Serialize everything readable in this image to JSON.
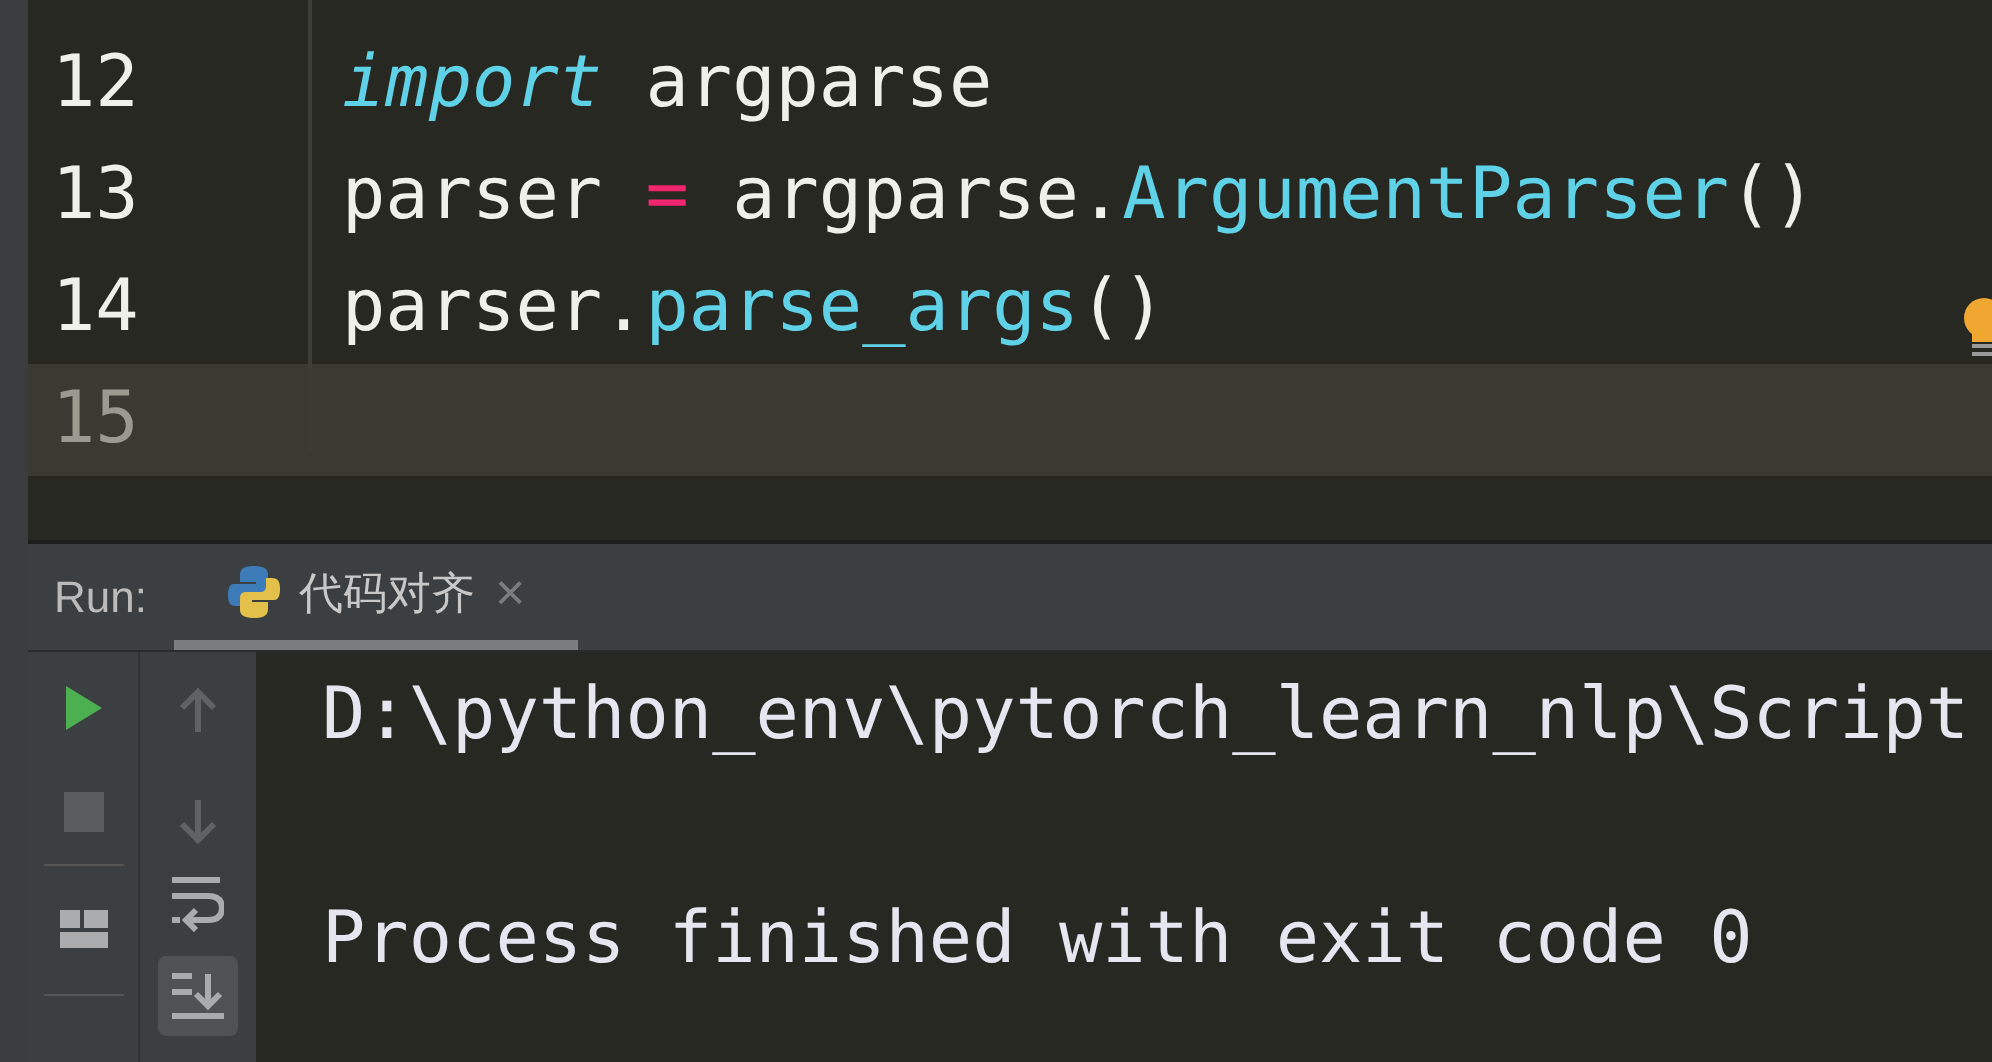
{
  "editor": {
    "lines": [
      {
        "number": "12",
        "current": false,
        "tokens": [
          {
            "text": "import",
            "kind": "keyword"
          },
          {
            "text": " argparse",
            "kind": "plain"
          }
        ]
      },
      {
        "number": "13",
        "current": false,
        "tokens": [
          {
            "text": "parser ",
            "kind": "plain"
          },
          {
            "text": "=",
            "kind": "operator"
          },
          {
            "text": " argparse.",
            "kind": "plain"
          },
          {
            "text": "ArgumentParser",
            "kind": "call"
          },
          {
            "text": "()",
            "kind": "plain"
          }
        ]
      },
      {
        "number": "14",
        "current": false,
        "tokens": [
          {
            "text": "parser.",
            "kind": "plain"
          },
          {
            "text": "parse_args",
            "kind": "call"
          },
          {
            "text": "()",
            "kind": "plain"
          }
        ]
      },
      {
        "number": "15",
        "current": true
      }
    ]
  },
  "run_panel": {
    "label": "Run:",
    "tabs": [
      {
        "title": "代码对齐",
        "selected": true,
        "close": "×"
      }
    ],
    "console": [
      "D:\\python_env\\pytorch_learn_nlp\\Script",
      "Process finished with exit code 0"
    ]
  }
}
